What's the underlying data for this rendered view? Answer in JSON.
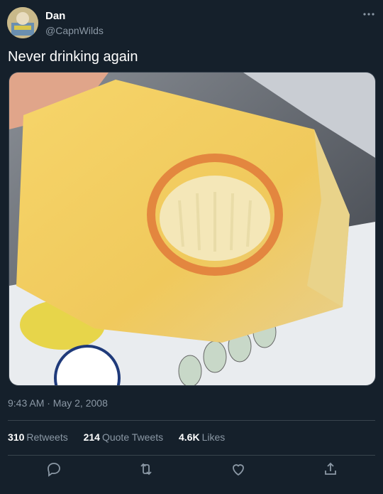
{
  "user": {
    "name": "Dan",
    "handle": "@CapnWilds"
  },
  "tweet": {
    "text": "Never drinking again",
    "timestamp": "9:43 AM · May 2, 2008"
  },
  "stats": [
    {
      "value": "310",
      "label": "Retweets"
    },
    {
      "value": "214",
      "label": "Quote Tweets"
    },
    {
      "value": "4.6K",
      "label": "Likes"
    }
  ],
  "icons": {
    "more": "more-horizontal-icon",
    "reply": "reply-icon",
    "retweet": "retweet-icon",
    "like": "heart-icon",
    "share": "share-icon"
  },
  "colors": {
    "background": "#15202b",
    "secondary_text": "#8b98a5",
    "divider": "#38444d"
  }
}
